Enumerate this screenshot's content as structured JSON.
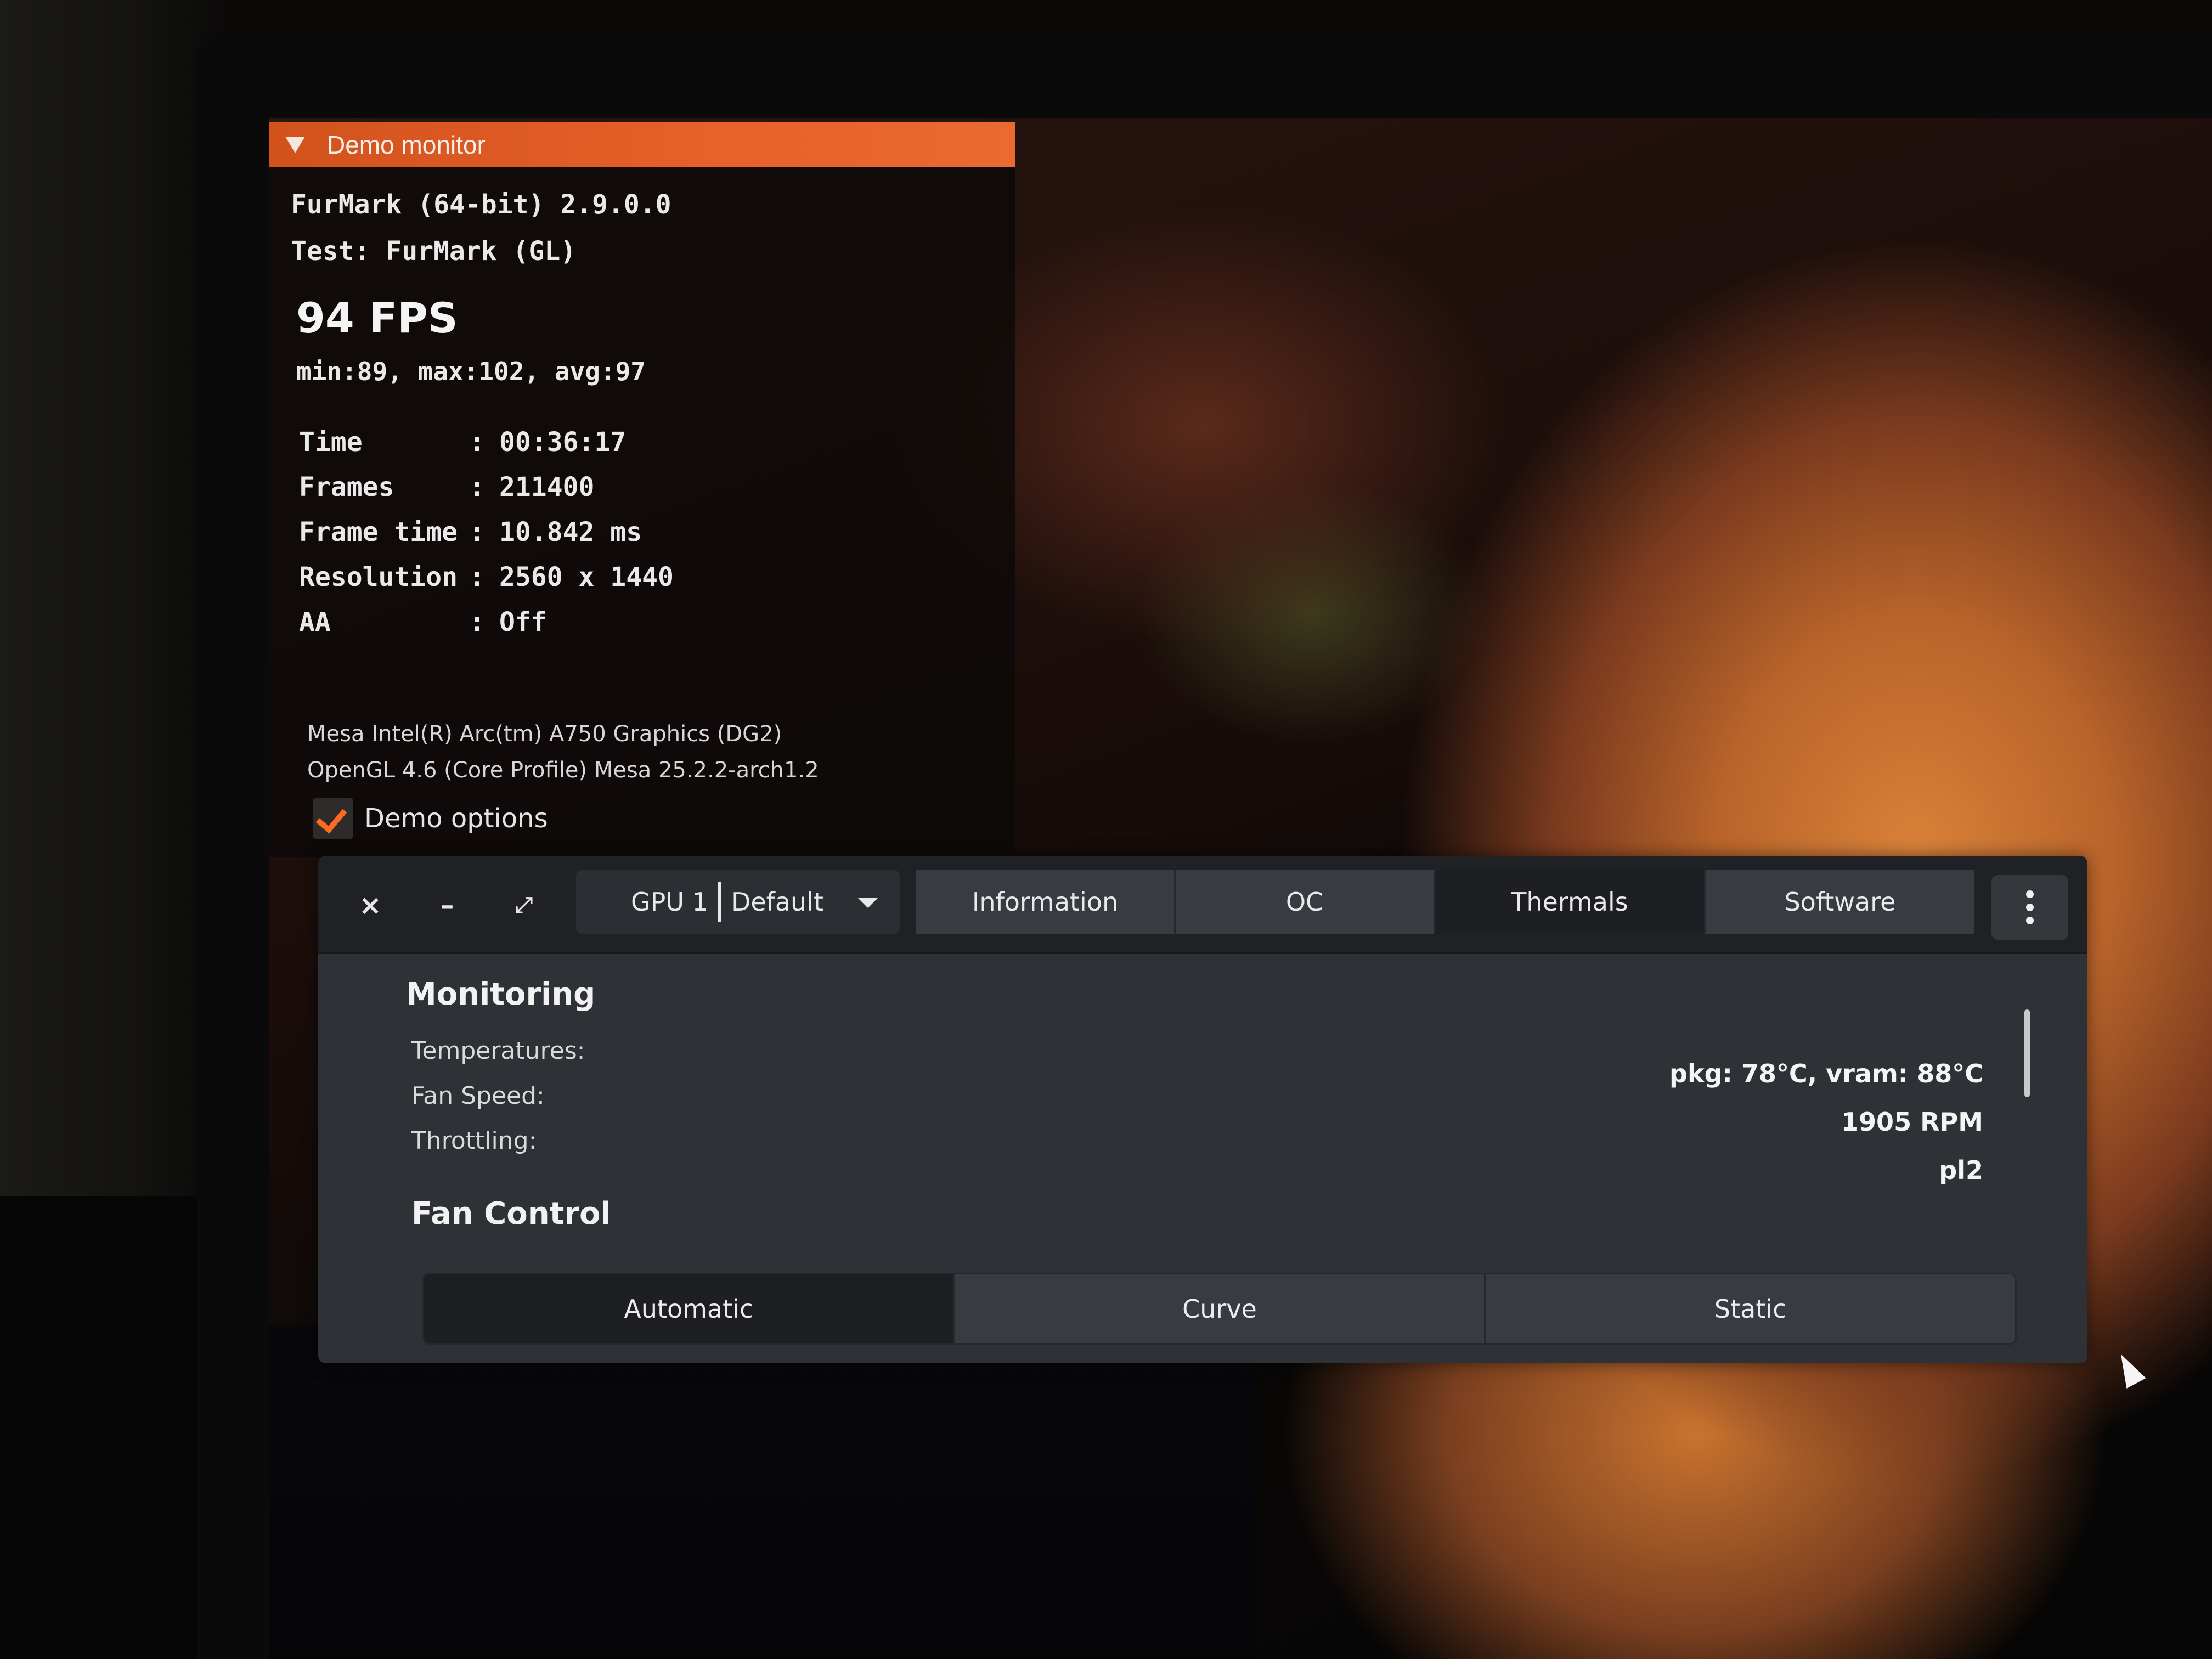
{
  "demo_monitor": {
    "header": "Demo monitor",
    "app_line": "FurMark (64-bit) 2.9.0.0",
    "test_line": "Test: FurMark (GL)",
    "fps": "94 FPS",
    "fps_stats": "min:89, max:102, avg:97",
    "stats": [
      {
        "key": "Time",
        "value": "00:36:17"
      },
      {
        "key": "Frames",
        "value": "211400"
      },
      {
        "key": "Frame time",
        "value": "10.842 ms"
      },
      {
        "key": "Resolution",
        "value": "2560 x 1440"
      },
      {
        "key": "AA",
        "value": "Off"
      }
    ],
    "colon": ":",
    "renderer": "Mesa Intel(R) Arc(tm) A750 Graphics (DG2)",
    "gl_version": "OpenGL 4.6 (Core Profile) Mesa 25.2.2-arch1.2",
    "options_label": "Demo options",
    "options_checked": true,
    "accent_color": "#e8602a"
  },
  "window": {
    "close_glyph": "×",
    "minimize_glyph": "–",
    "maximize_glyph": "⤢",
    "gpu_selector": {
      "gpu": "GPU 1",
      "profile": "Default"
    },
    "tabs": [
      "Information",
      "OC",
      "Thermals",
      "Software"
    ],
    "active_tab": "Thermals",
    "monitoring": {
      "title": "Monitoring",
      "rows": [
        {
          "label": "Temperatures:",
          "value": "pkg: 78°C, vram: 88°C"
        },
        {
          "label": "Fan Speed:",
          "value": "1905 RPM"
        },
        {
          "label": "Throttling:",
          "value": "pl2"
        }
      ]
    },
    "fan_control": {
      "title": "Fan Control",
      "modes": [
        "Automatic",
        "Curve",
        "Static"
      ],
      "active_mode": "Automatic"
    }
  }
}
